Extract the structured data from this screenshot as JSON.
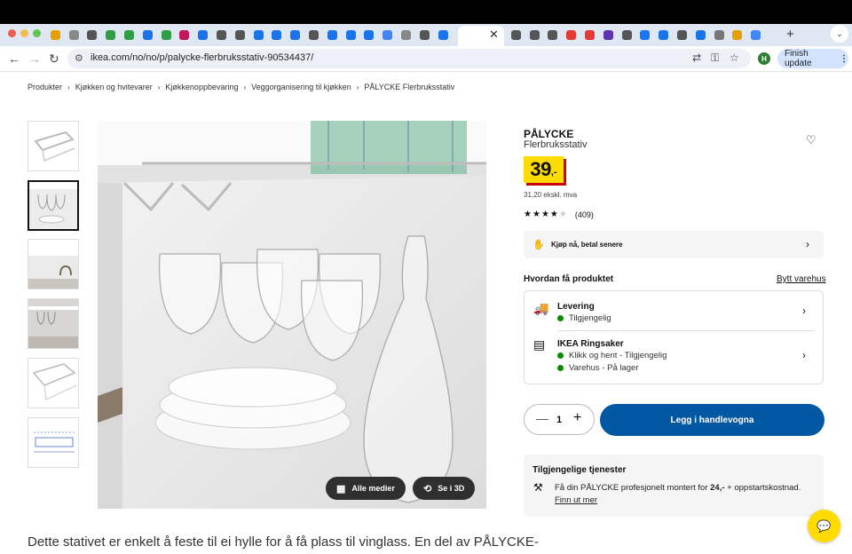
{
  "browser": {
    "url": "ikea.com/no/no/p/palycke-flerbruksstativ-90534437/",
    "finish_update_label": "Finish update",
    "profile_initial": "H",
    "tab_icon_colors": [
      "#e8a000",
      "#888",
      "#555",
      "#2f9e44",
      "#2f9e44",
      "#1a73e8",
      "#2f9e44",
      "#c2185b",
      "#1a73e8",
      "#555",
      "#555",
      "#1a73e8",
      "#1a73e8",
      "#1a73e8",
      "#555",
      "#1a73e8",
      "#1a73e8",
      "#1a73e8",
      "#4285f4",
      "#888",
      "#555",
      "#1a73e8"
    ],
    "tab_icon_colors_right": [
      "#555",
      "#555",
      "#555",
      "#e53935",
      "#e53935",
      "#5e35b1",
      "#555",
      "#1877f2",
      "#1a73e8",
      "#555",
      "#1a73e8",
      "#777",
      "#e8a000",
      "#4285f4"
    ]
  },
  "breadcrumb": [
    "Produkter",
    "Kjøkken og hvitevarer",
    "Kjøkkenoppbevaring",
    "Veggorganisering til kjøkken",
    "PÅLYCKE Flerbruksstativ"
  ],
  "media": {
    "all_media_label": "Alle medier",
    "view_3d_label": "Se i 3D"
  },
  "product": {
    "name": "PÅLYCKE",
    "description": "Flerbruksstativ",
    "price_integer": "39",
    "price_decimal": ",-",
    "price_ex_vat": "31,20 ekskl. mva",
    "rating": 4,
    "rating_count": "(409)",
    "accent_yellow": "#ffdb00",
    "accent_blue": "#0058a3"
  },
  "payment": {
    "label": "Kjøp nå, betal senere"
  },
  "fulfillment": {
    "title": "Hvordan få produktet",
    "switch_store": "Bytt varehus",
    "delivery_title": "Levering",
    "delivery_status": "Tilgjengelig",
    "store_title": "IKEA Ringsaker",
    "store_line1": "Klikk og hent - Tilgjengelig",
    "store_line2": "Varehus - På lager"
  },
  "cart": {
    "quantity": "1",
    "add_label": "Legg i handlevogna"
  },
  "services": {
    "title": "Tilgjengelige tjenester",
    "text_before": "Få din PÅLYCKE profesjonelt montert for ",
    "price": "24,-",
    "text_after": " + oppstartskostnad. ",
    "link": "Finn ut mer"
  },
  "product_description": "Dette stativet er enkelt å feste til ei hylle for å få plass til vinglass. En del av PÅLYCKE-"
}
